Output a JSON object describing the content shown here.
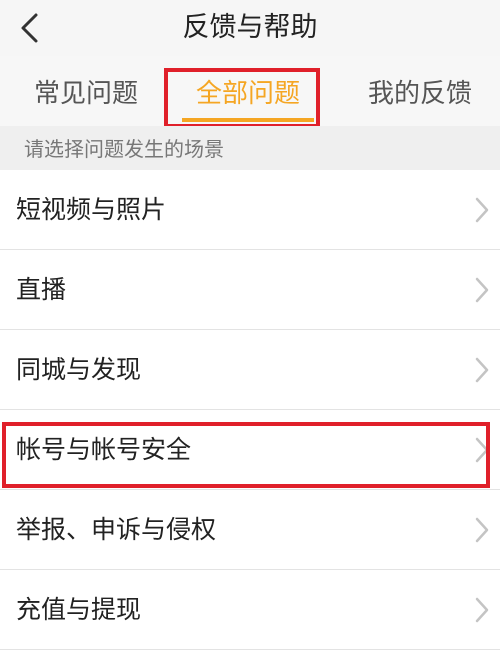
{
  "header": {
    "title": "反馈与帮助",
    "back_icon": "chevron-left-icon"
  },
  "tabs": [
    {
      "label": "常见问题",
      "selected": false
    },
    {
      "label": "全部问题",
      "selected": true
    },
    {
      "label": "我的反馈",
      "selected": false
    }
  ],
  "section": {
    "label": "请选择问题发生的场景"
  },
  "list": {
    "items": [
      {
        "label": "短视频与照片"
      },
      {
        "label": "直播"
      },
      {
        "label": "同城与发现"
      },
      {
        "label": "帐号与帐号安全"
      },
      {
        "label": "举报、申诉与侵权"
      },
      {
        "label": "充值与提现"
      }
    ],
    "chevron_icon": "chevron-right-icon"
  },
  "colors": {
    "accent": "#f5a623",
    "highlight": "#e0202a",
    "header_bg": "#f6f6f6",
    "section_bg": "#efefef"
  }
}
